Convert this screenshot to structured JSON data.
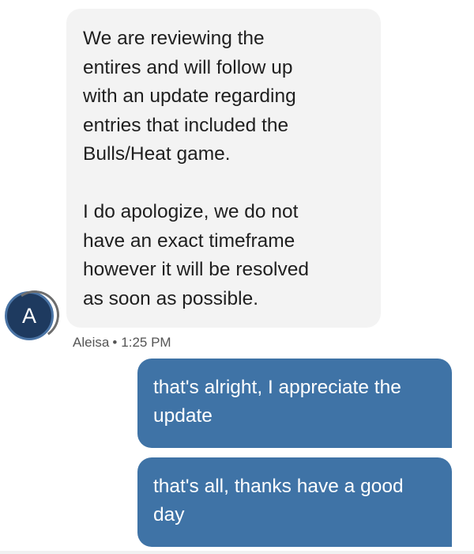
{
  "messages": {
    "incoming": {
      "text": "We are reviewing the\nentires and will follow up\nwith an update regarding\nentries that included the\nBulls/Heat game.\n\nI do apologize, we do not\nhave an exact timeframe\nhowever it will be resolved\nas soon as possible.",
      "avatar_letter": "A",
      "sender": "Aleisa",
      "separator": "•",
      "time": "1:25 PM"
    },
    "outgoing": [
      {
        "text": "that's alright, I appreciate the update"
      },
      {
        "text": "that's all, thanks have a good day"
      }
    ]
  },
  "colors": {
    "incoming_bubble": "#f3f3f3",
    "outgoing_bubble": "#3f73a6",
    "avatar_bg": "#1e3a5f"
  }
}
